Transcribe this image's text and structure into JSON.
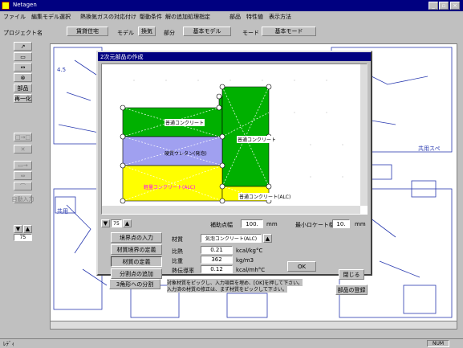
{
  "app": {
    "title": "Netagen",
    "status_ready": "ﾚﾃﾞｨ",
    "status_num": "NUM"
  },
  "menu": [
    "ファイル",
    "編集モデル選択",
    "熱換気ガスの対応付け",
    "駆動条件",
    "解の追加処理指定",
    "部品",
    "特性値",
    "表示方法"
  ],
  "header": {
    "project_label": "プロジェクト名",
    "project_value": "賃貸住宅",
    "model_label": "モデル",
    "model_value": "換気",
    "part_label": "部分",
    "part_value": "基本モデル",
    "mode_label": "モード",
    "mode_value": "基本モード"
  },
  "left_tools": {
    "parts_label": "部品",
    "redisplay_label": "再一化",
    "zoom_label": "75",
    "grid_label": "自動入力"
  },
  "dialog": {
    "title": "2次元部品の作成",
    "regions": [
      "普通コンクリート",
      "普通コンクリート",
      "硬質ウレタン(発泡)",
      "軽量コンクリート(ALC)",
      "普通コンクリート(ALC)"
    ],
    "zoom_value": "75",
    "aux_grid_label": "補助点幅",
    "aux_grid_value": "100.",
    "aux_grid_unit": "mm",
    "min_mesh_label": "最小ロケート幅",
    "min_mesh_value": "10.",
    "min_mesh_unit": "mm",
    "buttons": {
      "boundary_input": "境界点の入力",
      "material_boundary": "材質境界の定義",
      "material_def": "材質の定義",
      "split_add": "分割点の追加",
      "triangle_split": "3角形への分割",
      "ok": "OK",
      "close": "閉じる",
      "register": "部品の登録"
    },
    "material": {
      "name_label": "材質",
      "name_value": "気泡コンクリート(ALC)",
      "heat_label": "比熱",
      "heat_value": "0.21",
      "heat_unit": "kcal/kg°C",
      "density_label": "比重",
      "density_value": "362",
      "density_unit": "kg/m3",
      "cond_label": "熱伝導率",
      "cond_value": "0.12",
      "cond_unit": "kcal/mh°C"
    },
    "hint_line1": "対象材質をピックし、入力項目を埋め、[OK]を押して下さい。",
    "hint_line2": "入力済の材質の修正は、まず材質をピックして下さい。"
  },
  "colors": {
    "green": "#00b000",
    "lavender": "#a0a0f0",
    "yellow": "#ffff00",
    "titlebar": "#000080"
  }
}
